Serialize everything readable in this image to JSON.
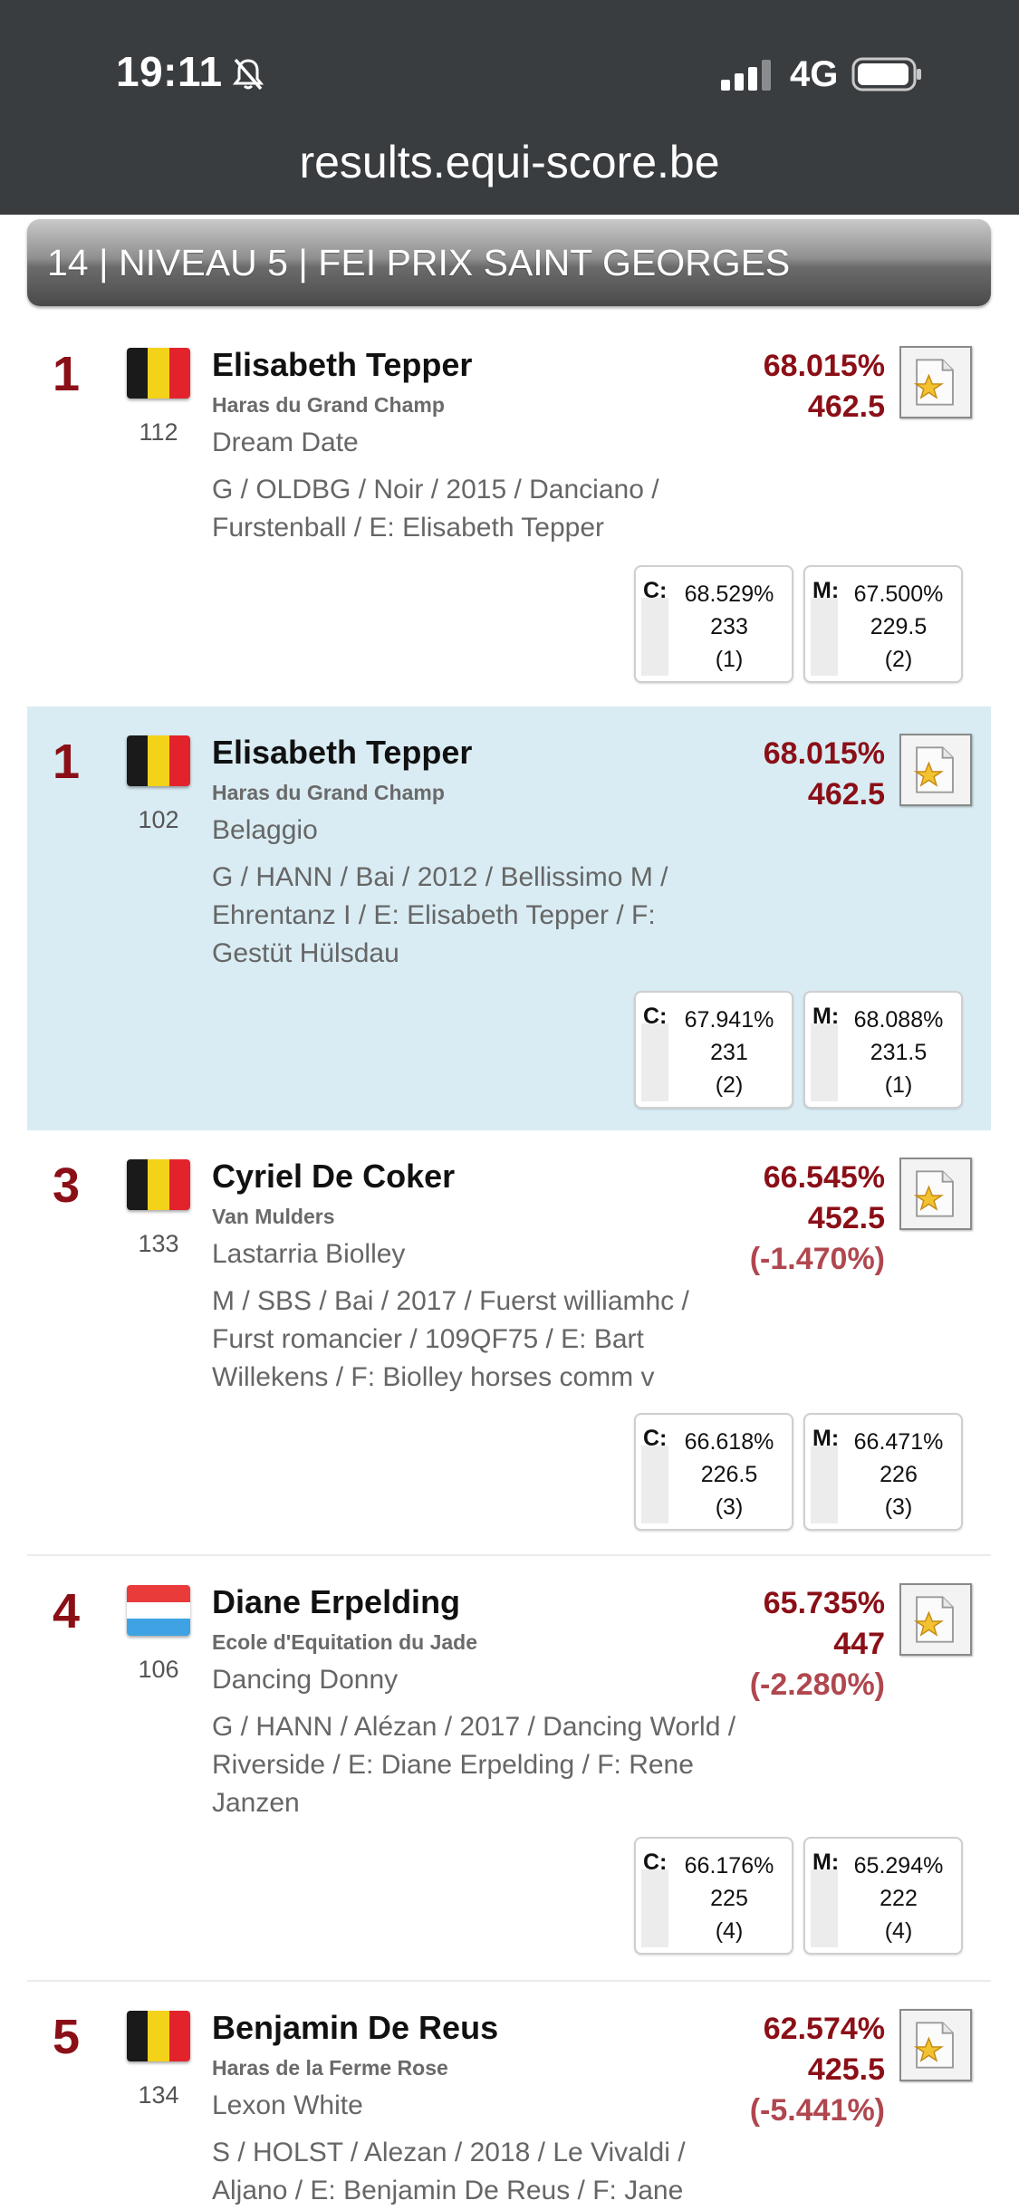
{
  "status_bar": {
    "time": "19:11",
    "network": "4G"
  },
  "browser": {
    "url": "results.equi-score.be"
  },
  "section": {
    "title": "14 | NIVEAU 5 | FEI PRIX SAINT GEORGES"
  },
  "results": [
    {
      "rank": "1",
      "bib": "112",
      "flag": "belgium",
      "rider": "Elisabeth Tepper",
      "club": "Haras du Grand Champ",
      "horse": "Dream Date",
      "details": "G / OLDBG / Noir / 2015 / Danciano / Furstenball / E: Elisabeth Tepper",
      "percent": "68.015%",
      "points": "462.5",
      "diff": "",
      "judge_c": {
        "label": "C:",
        "percent": "68.529%",
        "points": "233",
        "rank": "(1)"
      },
      "judge_m": {
        "label": "M:",
        "percent": "67.500%",
        "points": "229.5",
        "rank": "(2)"
      }
    },
    {
      "rank": "1",
      "bib": "102",
      "flag": "belgium",
      "rider": "Elisabeth Tepper",
      "club": "Haras du Grand Champ",
      "horse": "Belaggio",
      "details": "G / HANN / Bai / 2012 / Bellissimo M / Ehrentanz I / E: Elisabeth Tepper / F: Gestüt Hülsdau",
      "percent": "68.015%",
      "points": "462.5",
      "diff": "",
      "judge_c": {
        "label": "C:",
        "percent": "67.941%",
        "points": "231",
        "rank": "(2)"
      },
      "judge_m": {
        "label": "M:",
        "percent": "68.088%",
        "points": "231.5",
        "rank": "(1)"
      }
    },
    {
      "rank": "3",
      "bib": "133",
      "flag": "belgium",
      "rider": "Cyriel De Coker",
      "club": "Van Mulders",
      "horse": "Lastarria Biolley",
      "details": "M / SBS / Bai / 2017 / Fuerst williamhc / Furst romancier / 109QF75 / E: Bart Willekens / F: Biolley horses comm v",
      "percent": "66.545%",
      "points": "452.5",
      "diff": "(-1.470%)",
      "judge_c": {
        "label": "C:",
        "percent": "66.618%",
        "points": "226.5",
        "rank": "(3)"
      },
      "judge_m": {
        "label": "M:",
        "percent": "66.471%",
        "points": "226",
        "rank": "(3)"
      }
    },
    {
      "rank": "4",
      "bib": "106",
      "flag": "luxembourg",
      "rider": "Diane Erpelding",
      "club": "Ecole d'Equitation du Jade",
      "horse": "Dancing Donny",
      "details": "G / HANN / Alézan / 2017 / Dancing World / Riverside / E: Diane Erpelding / F: Rene Janzen",
      "percent": "65.735%",
      "points": "447",
      "diff": "(-2.280%)",
      "judge_c": {
        "label": "C:",
        "percent": "66.176%",
        "points": "225",
        "rank": "(4)"
      },
      "judge_m": {
        "label": "M:",
        "percent": "65.294%",
        "points": "222",
        "rank": "(4)"
      }
    },
    {
      "rank": "5",
      "bib": "134",
      "flag": "belgium",
      "rider": "Benjamin De Reus",
      "club": "Haras de la Ferme Rose",
      "horse": "Lexon White",
      "details": "S / HOLST / Alezan / 2018 / Le Vivaldi / Aljano / E: Benjamin De Reus / F: Jane",
      "percent": "62.574%",
      "points": "425.5",
      "diff": "(-5.441%)"
    }
  ],
  "colors": {
    "rank": "#8b0f17",
    "score": "#8b0f17",
    "diff": "#b0474f",
    "highlight_row": "#d9ecf3",
    "chrome": "#3a3d40"
  }
}
